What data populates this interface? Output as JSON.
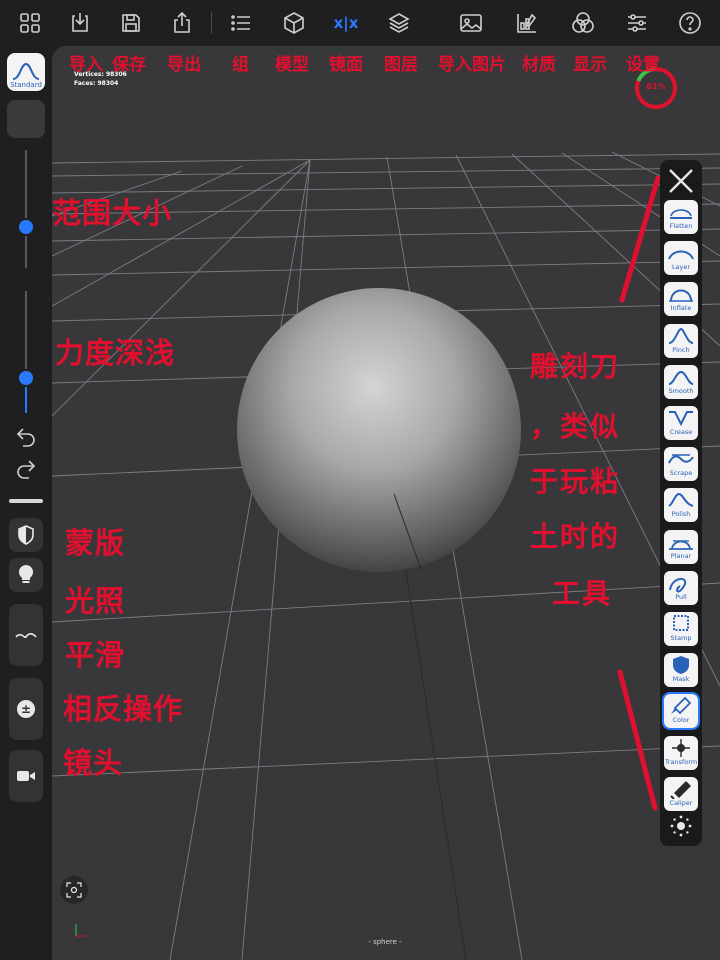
{
  "toolbar": {
    "icons": [
      "grid-icon",
      "import-icon",
      "save-icon",
      "export-icon",
      "list-icon",
      "cube-icon",
      "mirror-icon",
      "layers-icon",
      "image-icon",
      "material-icon",
      "display-icon",
      "settings-icon",
      "help-icon"
    ],
    "mirror_label": "x|x",
    "accent_color": "#2979ff"
  },
  "annotations_top": [
    "导入",
    "保存",
    "导出",
    "组",
    "模型",
    "镜面",
    "图层",
    "导入图片",
    "材质",
    "显示",
    "设置"
  ],
  "stats": {
    "vertices": "Vertices: 98306",
    "faces": "Faces:    98304"
  },
  "meter": {
    "label": "81%",
    "value": 0.81,
    "ring_color": "#e0102e",
    "progress_color": "#3cc04a"
  },
  "left_bar": {
    "brush_label": "Standard",
    "radius_value": 0.35,
    "intensity_value": 0.29,
    "undo_icon": "undo-icon",
    "redo_icon": "redo-icon",
    "mask_icon": "mask-shield-icon",
    "light_icon": "bulb-icon",
    "smooth_icon": "smooth-wave-icon",
    "invert_label": "±",
    "camera_icon": "video-camera-icon"
  },
  "annotations_left": {
    "radius": "范围大小",
    "intensity": "力度深浅",
    "mask": "蒙版",
    "light": "光照",
    "smooth": "平滑",
    "invert": "相反操作",
    "camera": "镜头"
  },
  "annotations_right": [
    "雕刻刀",
    "，类似",
    "于玩粘",
    "土时的",
    "工具"
  ],
  "tools": [
    {
      "label": "Flatten"
    },
    {
      "label": "Layer"
    },
    {
      "label": "Inflate"
    },
    {
      "label": "Pinch"
    },
    {
      "label": "Smooth"
    },
    {
      "label": "Crease"
    },
    {
      "label": "Scrape"
    },
    {
      "label": "Polish"
    },
    {
      "label": "Planar"
    },
    {
      "label": "Pull"
    },
    {
      "label": "Stamp"
    },
    {
      "label": "Mask"
    },
    {
      "label": "Color"
    },
    {
      "label": "Transform"
    },
    {
      "label": "Caliper"
    }
  ],
  "selected_tool": "Color",
  "mesh_name": "- sphere -"
}
